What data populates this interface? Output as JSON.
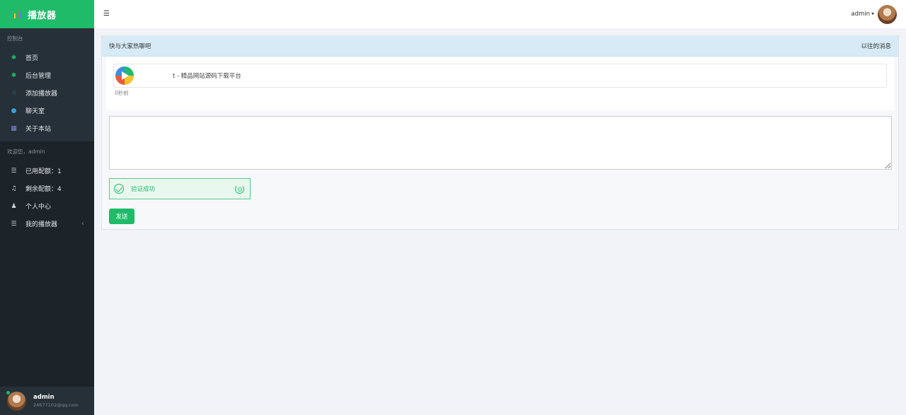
{
  "brand": {
    "title": "播放器",
    "icon_colors": [
      "#f2c12e",
      "#e95a3c",
      "#3a8fe0"
    ]
  },
  "sidebar": {
    "section1_heading": "控制台",
    "section1_items": [
      {
        "label": "首页",
        "icon": "gear-icon",
        "icon_color": "#1fbb69"
      },
      {
        "label": "后台管理",
        "icon": "gear-icon",
        "icon_color": "#1fbb69"
      },
      {
        "label": "添加播放器",
        "icon": "thumbs-up-icon",
        "icon_color": "#3a9fd8"
      },
      {
        "label": "聊天室",
        "icon": "chat-icon",
        "icon_color": "#3a9fd8"
      },
      {
        "label": "关于本站",
        "icon": "grid-icon",
        "icon_color": "#7b8fd8"
      }
    ],
    "section2_heading": "欢迎您，admin",
    "section2_items": [
      {
        "label": "已用配额：1",
        "icon": "list-icon"
      },
      {
        "label": "剩余配额：4",
        "icon": "music-icon"
      },
      {
        "label": "个人中心",
        "icon": "user-icon"
      },
      {
        "label": "我的播放器",
        "icon": "list-icon",
        "chevron": "‹"
      }
    ]
  },
  "user": {
    "name": "admin",
    "email": "24677102@qq.com"
  },
  "topbar": {
    "menu_icon": "☰",
    "admin_label": "admin"
  },
  "chat": {
    "title": "快与大家热聊吧",
    "history_link": "以往的消息",
    "message_text": "t - 精品网站源码下载平台",
    "message_time": "0秒前",
    "input_value": "",
    "captcha_text": "验证成功",
    "send_label": "发送"
  },
  "colors": {
    "accent": "#1fbb69",
    "sidebar_bg": "#1c2329",
    "panel_head_bg": "#d6ebf5"
  }
}
